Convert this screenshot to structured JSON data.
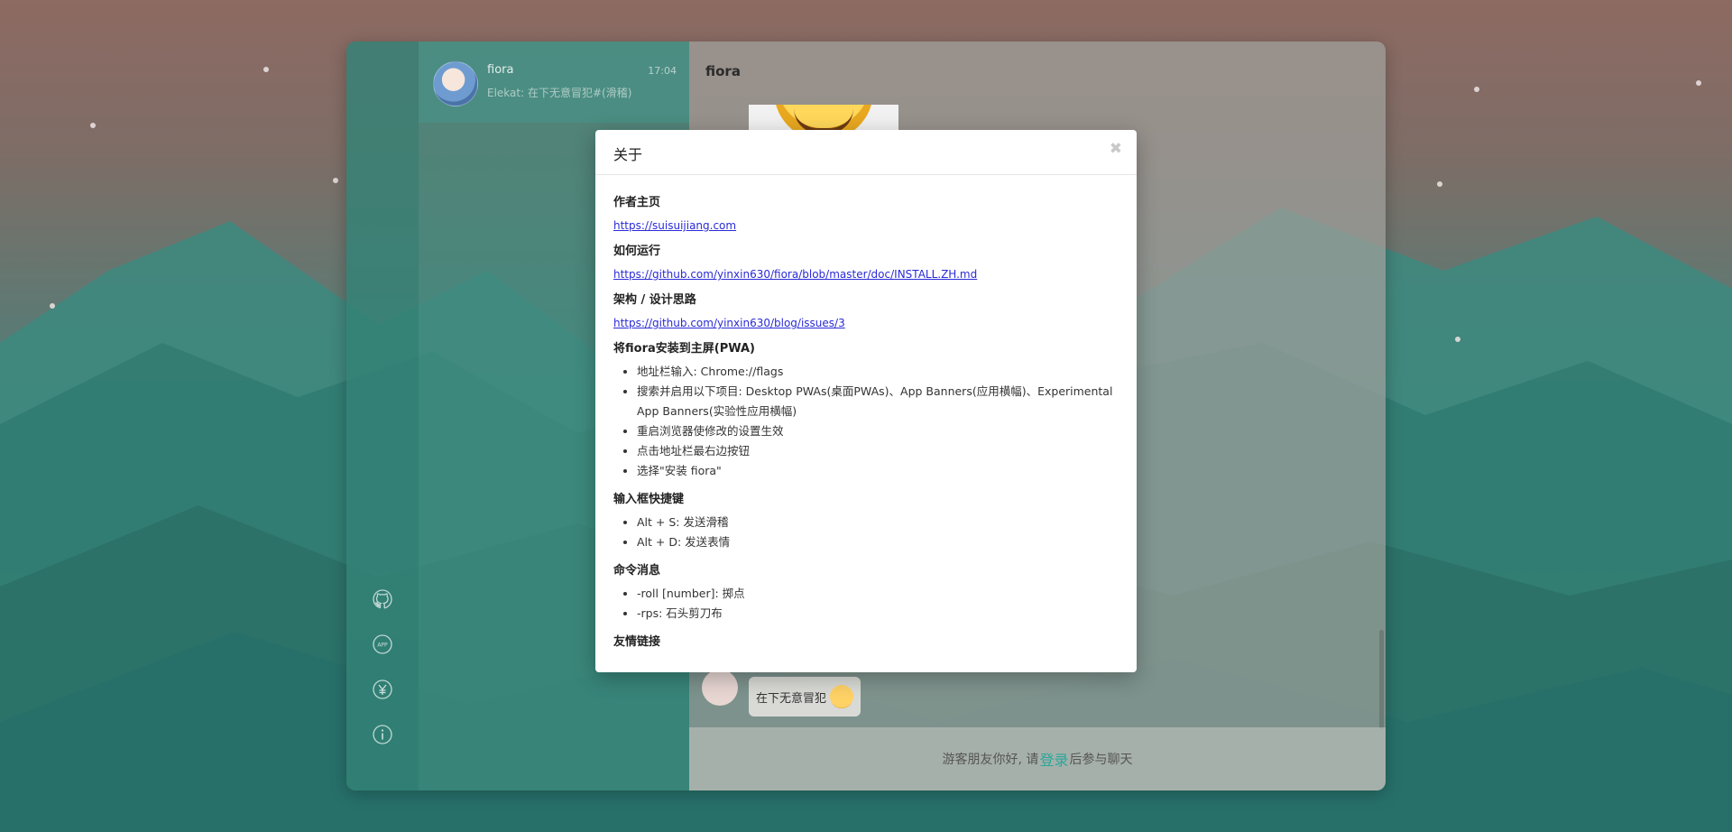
{
  "contacts": {
    "items": [
      {
        "name": "fiora",
        "time": "17:04",
        "preview": "Elekat: 在下无意冒犯#(滑稽)"
      }
    ]
  },
  "sidebar": {
    "icons": [
      "github-icon",
      "app-icon",
      "yen-icon",
      "info-icon"
    ]
  },
  "chat": {
    "title": "fiora",
    "message_text": "在下无意冒犯",
    "footer_prefix": "游客朋友你好, 请",
    "footer_link": "登录",
    "footer_suffix": "后参与聊天"
  },
  "dialog": {
    "title": "关于",
    "close_symbol": "✖",
    "sections": {
      "author": {
        "title": "作者主页",
        "link": "https://suisuijiang.com"
      },
      "run": {
        "title": "如何运行",
        "link": "https://github.com/yinxin630/fiora/blob/master/doc/INSTALL.ZH.md"
      },
      "arch": {
        "title": "架构 / 设计思路",
        "link": "https://github.com/yinxin630/blog/issues/3"
      },
      "pwa": {
        "title": "将fiora安装到主屏(PWA)",
        "items": [
          "地址栏输入: Chrome://flags",
          "搜索并启用以下项目: Desktop PWAs(桌面PWAs)、App Banners(应用横幅)、Experimental App Banners(实验性应用横幅)",
          "重启浏览器使修改的设置生效",
          "点击地址栏最右边按钮",
          "选择\"安装 fiora\""
        ]
      },
      "shortcuts": {
        "title": "输入框快捷键",
        "items": [
          "Alt + S: 发送滑稽",
          "Alt + D: 发送表情"
        ]
      },
      "commands": {
        "title": "命令消息",
        "items": [
          "-roll [number]: 掷点",
          "-rps: 石头剪刀布"
        ]
      },
      "links": {
        "title": "友情链接"
      }
    }
  }
}
